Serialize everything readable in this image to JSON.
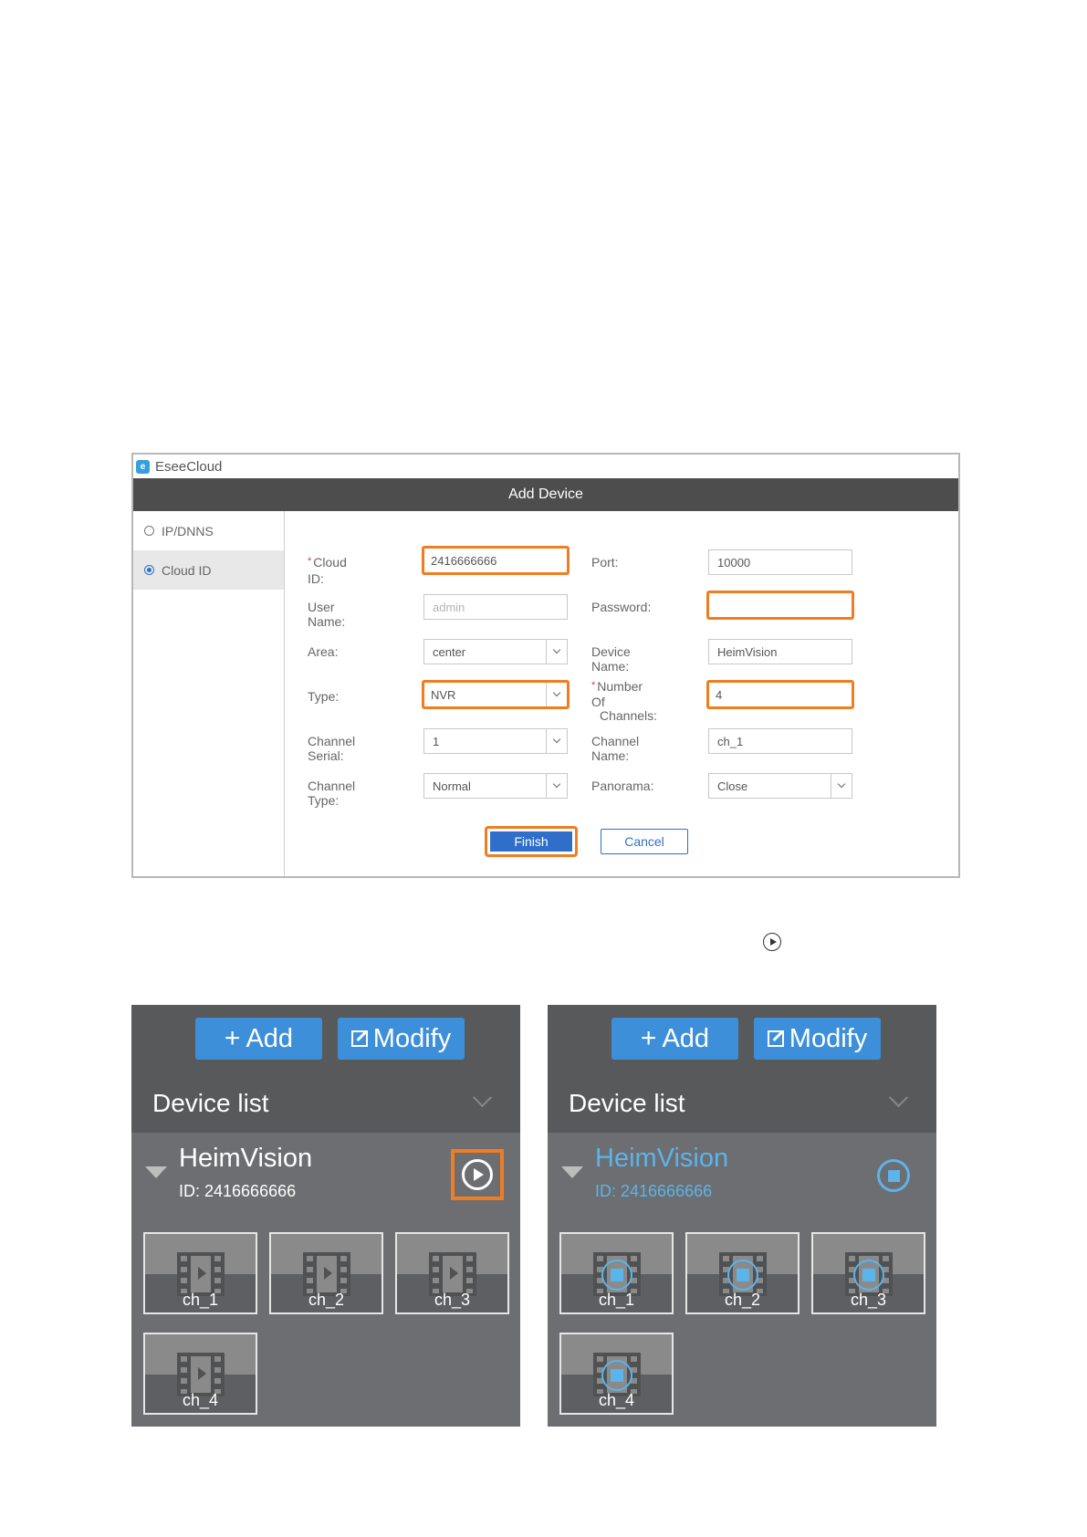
{
  "dialog": {
    "app_title": "EseeCloud",
    "header_title": "Add Device",
    "sidebar": [
      {
        "label": "IP/DNNS",
        "selected": false
      },
      {
        "label": "Cloud ID",
        "selected": true
      }
    ],
    "fields": {
      "cloud_id": {
        "label": "Cloud ID:",
        "value": "2416666666"
      },
      "port": {
        "label": "Port:",
        "value": "10000"
      },
      "user_name": {
        "label": "User Name:",
        "placeholder": "admin"
      },
      "password": {
        "label": "Password:",
        "value": ""
      },
      "area": {
        "label": "Area:",
        "value": "center"
      },
      "device_name": {
        "label": "Device Name:",
        "value": "HeimVision"
      },
      "type": {
        "label": "Type:",
        "value": "NVR"
      },
      "channels": {
        "label": "Number Of Channels:",
        "label_line1": "Number Of",
        "label_line2": "Channels:",
        "value": "4"
      },
      "channel_serial": {
        "label": "Channel Serial:",
        "value": "1"
      },
      "channel_name": {
        "label": "Channel Name:",
        "value": "ch_1"
      },
      "channel_type": {
        "label": "Channel Type:",
        "value": "Normal"
      },
      "panorama": {
        "label": "Panorama:",
        "value": "Close"
      }
    },
    "finish_label": "Finish",
    "cancel_label": "Cancel",
    "highlight_color": "#ef7d22",
    "accent_color": "#2f6fc9"
  },
  "panels": [
    {
      "state": "before",
      "add_label": "Add",
      "modify_label": "Modify",
      "list_title": "Device list",
      "device_name": "HeimVision",
      "device_id": "ID: 2416666666",
      "control_icon": "play-icon",
      "channels": [
        "ch_1",
        "ch_2",
        "ch_3",
        "ch_4"
      ]
    },
    {
      "state": "playing",
      "add_label": "Add",
      "modify_label": "Modify",
      "list_title": "Device list",
      "device_name": "HeimVision",
      "device_id": "ID: 2416666666",
      "control_icon": "stop-icon",
      "channels": [
        "ch_1",
        "ch_2",
        "ch_3",
        "ch_4"
      ]
    }
  ],
  "colors": {
    "panel_bg": "#6d6e71",
    "panel_header": "#58595b",
    "button_blue": "#3d8fd9",
    "active_blue": "#5bb4ea"
  }
}
